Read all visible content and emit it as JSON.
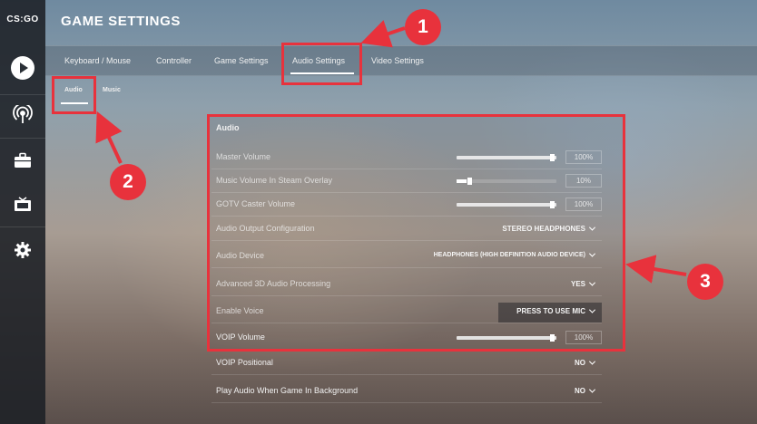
{
  "logo_text": "CS:GO",
  "title": "GAME SETTINGS",
  "tabs": [
    {
      "label": "Keyboard / Mouse"
    },
    {
      "label": "Controller"
    },
    {
      "label": "Game Settings"
    },
    {
      "label": "Audio Settings",
      "active": true
    },
    {
      "label": "Video Settings"
    }
  ],
  "subtabs": [
    {
      "label": "Audio",
      "active": true
    },
    {
      "label": "Music"
    }
  ],
  "sidebar_icons": [
    "play-icon",
    "broadcast-icon",
    "briefcase-icon",
    "tv-icon",
    "gear-icon"
  ],
  "section_title": "Audio",
  "settings": {
    "master_volume": {
      "label": "Master Volume",
      "value": "100%",
      "level": 1.0
    },
    "music_volume": {
      "label": "Music Volume In Steam Overlay",
      "value": "10%",
      "level": 0.1
    },
    "gotv_volume": {
      "label": "GOTV Caster Volume",
      "value": "100%",
      "level": 1.0
    },
    "output_config": {
      "label": "Audio Output Configuration",
      "value": "STEREO HEADPHONES"
    },
    "audio_device": {
      "label": "Audio Device",
      "value": "HEADPHONES (HIGH DEFINITION AUDIO DEVICE)"
    },
    "advanced_3d": {
      "label": "Advanced 3D Audio Processing",
      "value": "YES"
    },
    "enable_voice": {
      "label": "Enable Voice",
      "value": "PRESS TO USE MIC"
    },
    "voip_volume": {
      "label": "VOIP Volume",
      "value": "100%",
      "level": 1.0
    },
    "voip_positional": {
      "label": "VOIP Positional",
      "value": "NO"
    },
    "play_audio_bg": {
      "label": "Play Audio When Game In Background",
      "value": "NO"
    }
  },
  "annotations": {
    "one": "1",
    "two": "2",
    "three": "3",
    "color": "#e8323c"
  }
}
